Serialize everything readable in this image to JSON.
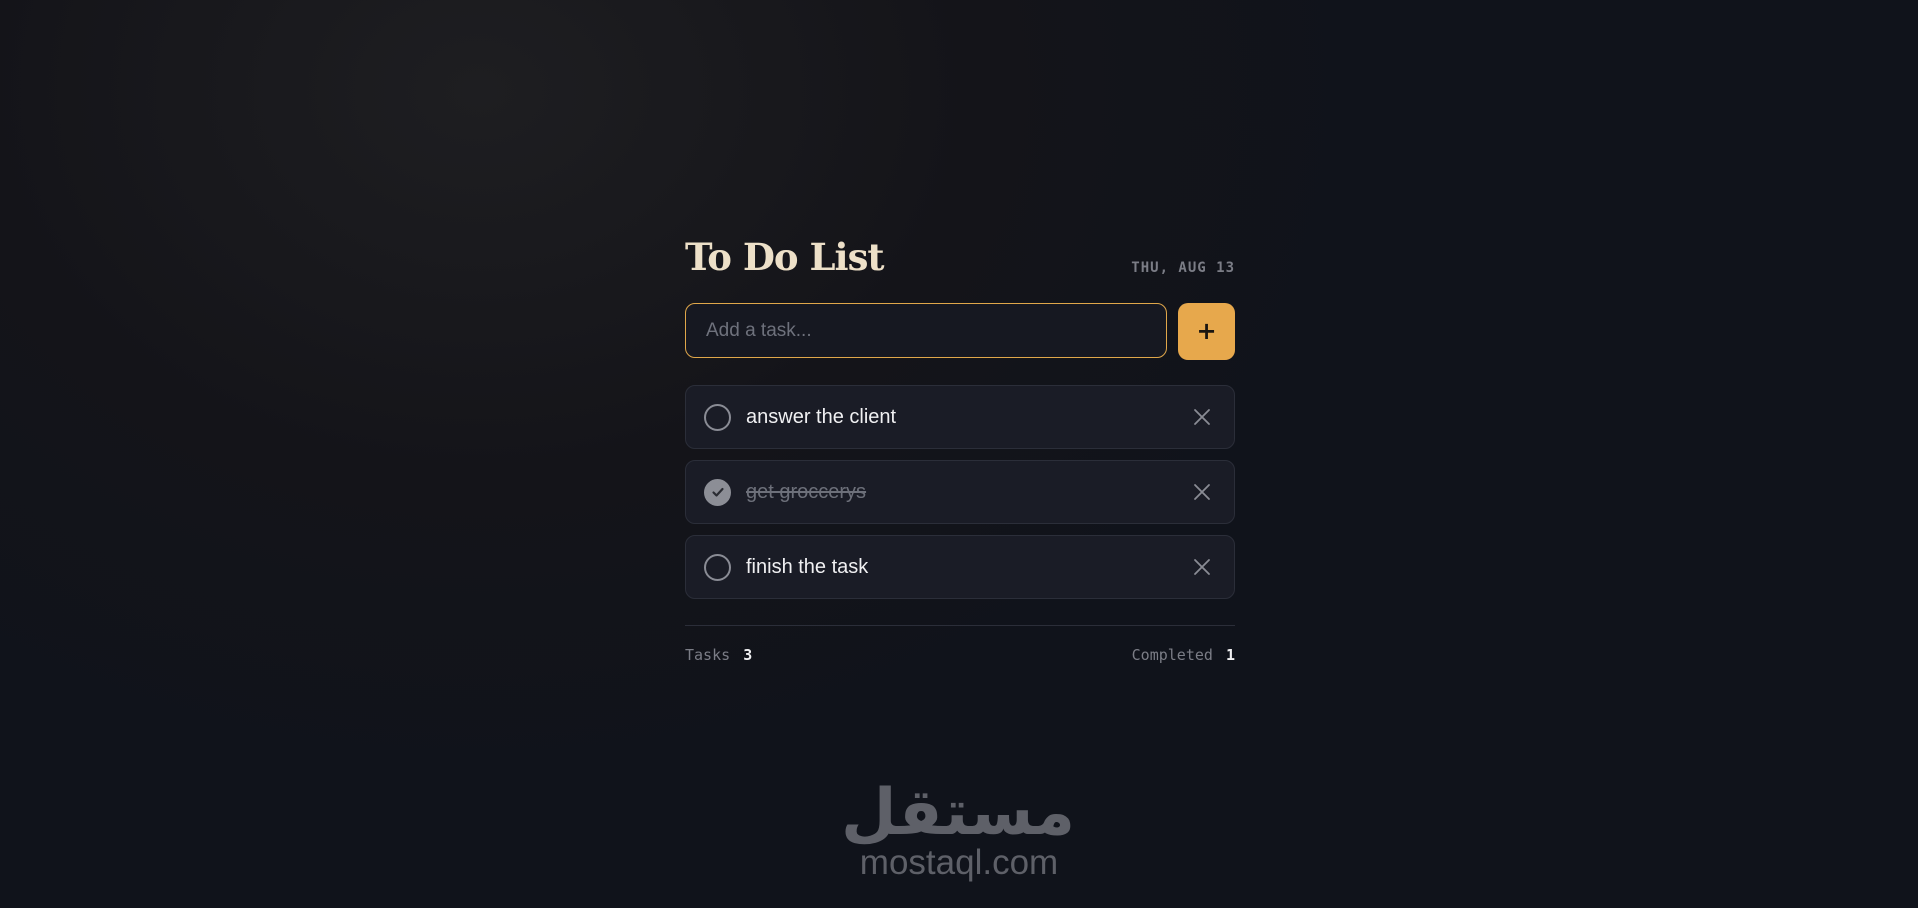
{
  "header": {
    "title": "To Do List",
    "date": "THU, AUG 13"
  },
  "input": {
    "placeholder": "Add a task...",
    "value": "",
    "add_label": "+"
  },
  "tasks": [
    {
      "text": "answer the client",
      "completed": false
    },
    {
      "text": "get groccerys",
      "completed": true
    },
    {
      "text": "finish the task",
      "completed": false
    }
  ],
  "footer": {
    "tasks_label": "Tasks",
    "tasks_count": "3",
    "completed_label": "Completed",
    "completed_count": "1"
  },
  "watermark": {
    "arabic": "مستقل",
    "latin": "mostaql.com"
  },
  "colors": {
    "accent": "#e7a84c",
    "title": "#ede0c8"
  },
  "icons": {
    "check": "circle-check-icon",
    "delete": "close-icon"
  }
}
